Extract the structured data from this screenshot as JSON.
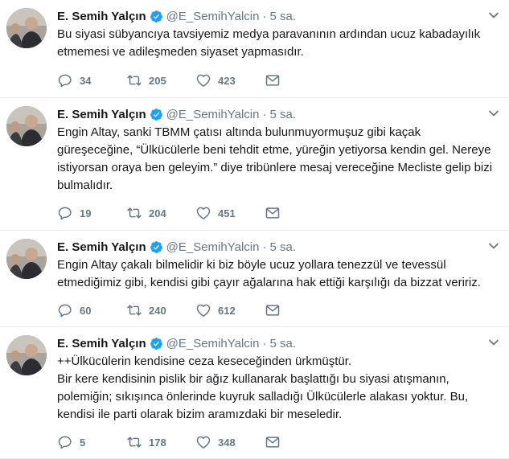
{
  "tweets": [
    {
      "fullname": "E. Semih Yalçın",
      "username": "@E_SemihYalcin",
      "dot": "·",
      "time": "5 sa.",
      "lines": [
        "Bu siyasi sübyancıya tavsiyemiz medya paravanının ardından ucuz kabadayılık",
        "etmemesi ve adileşmeden siyaset yapmasıdır."
      ],
      "replies": "34",
      "retweets": "205",
      "likes": "423"
    },
    {
      "fullname": "E. Semih Yalçın",
      "username": "@E_SemihYalcin",
      "dot": "·",
      "time": "5 sa.",
      "lines": [
        "Engin Altay, sanki TBMM çatısı altında bulunmuyormuşuz gibi kaçak",
        "güreşeceğine, “Ülkücülerle beni tehdit etme, yüreğin yetiyorsa kendin gel. Nereye",
        "istiyorsan oraya ben geleyim.” diye tribünlere mesaj vereceğine Mecliste gelip bizi",
        "bulmalıdır."
      ],
      "replies": "19",
      "retweets": "204",
      "likes": "451"
    },
    {
      "fullname": "E. Semih Yalçın",
      "username": "@E_SemihYalcin",
      "dot": "·",
      "time": "5 sa.",
      "lines": [
        "Engin Altay çakalı bilmelidir ki biz böyle ucuz yollara tenezzül ve tevessül",
        "etmediğimiz gibi, kendisi gibi çayır ağalarına hak ettiği karşılığı da bizzat veririz."
      ],
      "replies": "60",
      "retweets": "240",
      "likes": "612"
    },
    {
      "fullname": "E. Semih Yalçın",
      "username": "@E_SemihYalcin",
      "dot": "·",
      "time": "5 sa.",
      "lines": [
        "++Ülkücülerin kendisine ceza keseceğinden ürkmüştür.",
        "Bir kere kendisinin pislik bir ağız kullanarak başlattığı bu siyasi atışmanın,",
        "polemiğin; sıkışınca önlerinde kuyruk salladığı Ülkücülerle alakası yoktur. Bu,",
        "kendisi ile parti olarak bizim aramızdaki bir meseledir."
      ],
      "replies": "5",
      "retweets": "178",
      "likes": "348"
    }
  ],
  "icons": {
    "verified": "verified-badge-icon",
    "caret": "chevron-down-icon",
    "reply": "reply-icon",
    "retweet": "retweet-icon",
    "like": "heart-icon",
    "dm": "envelope-icon"
  },
  "colors": {
    "text": "#14171a",
    "muted": "#657786",
    "verified": "#1da1f2",
    "divider": "#e6ecf0"
  }
}
